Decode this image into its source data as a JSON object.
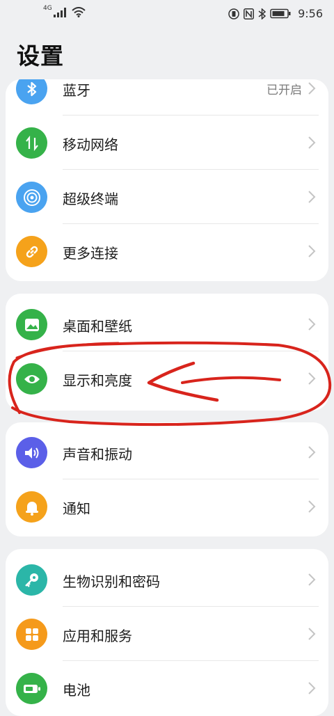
{
  "status_bar": {
    "network": "4G",
    "time": "9:56"
  },
  "page": {
    "title": "设置"
  },
  "groups": [
    {
      "items": [
        {
          "label": "蓝牙",
          "value": "已开启",
          "icon": "bluetooth-icon",
          "color": "#4aa3f0"
        },
        {
          "label": "移动网络",
          "icon": "mobile-data-icon",
          "color": "#35b249"
        },
        {
          "label": "超级终端",
          "icon": "super-device-icon",
          "color": "#4aa3f0"
        },
        {
          "label": "更多连接",
          "icon": "link-icon",
          "color": "#f5a21b"
        }
      ]
    },
    {
      "items": [
        {
          "label": "桌面和壁纸",
          "icon": "wallpaper-icon",
          "color": "#35b249"
        },
        {
          "label": "显示和亮度",
          "icon": "eye-icon",
          "color": "#35b249"
        }
      ]
    },
    {
      "items": [
        {
          "label": "声音和振动",
          "icon": "volume-icon",
          "color": "#5b5fe8"
        },
        {
          "label": "通知",
          "icon": "bell-icon",
          "color": "#f5a21b"
        }
      ]
    },
    {
      "items": [
        {
          "label": "生物识别和密码",
          "icon": "key-icon",
          "color": "#2bb6a8"
        },
        {
          "label": "应用和服务",
          "icon": "apps-icon",
          "color": "#f59a1b"
        },
        {
          "label": "电池",
          "icon": "battery-icon",
          "color": "#35b249"
        }
      ]
    }
  ],
  "colors": {
    "annotation": "#d8241c",
    "background": "#eff0f2"
  }
}
